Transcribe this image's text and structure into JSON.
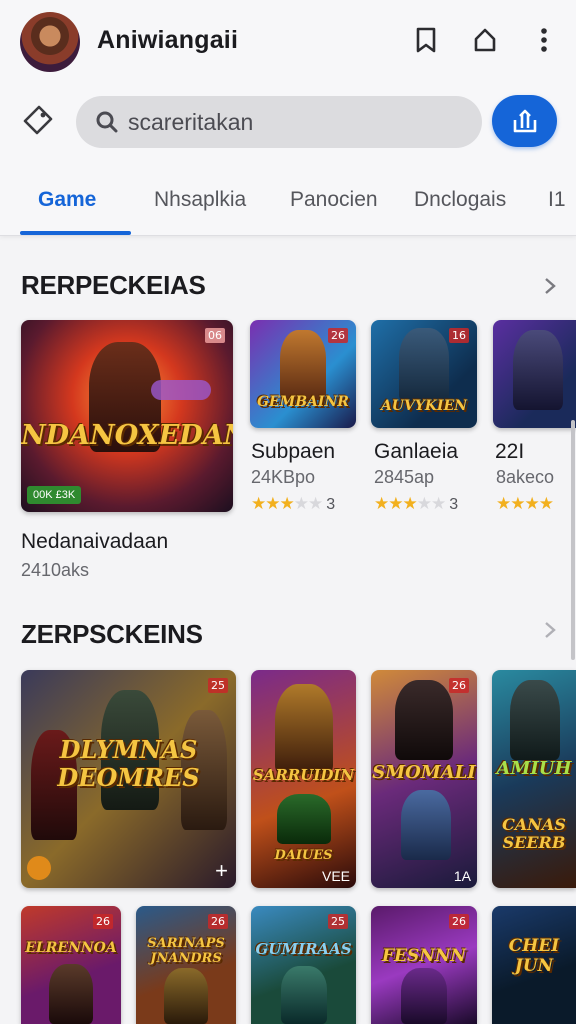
{
  "header": {
    "app_title": "Aniwiangaii",
    "search_placeholder": "scareritakan"
  },
  "tabs": [
    {
      "label": "Game",
      "active": true
    },
    {
      "label": "Nhsaplkia",
      "active": false
    },
    {
      "label": "Panocien",
      "active": false
    },
    {
      "label": "Dnclogais",
      "active": false
    },
    {
      "label": "I1",
      "active": false
    }
  ],
  "section1": {
    "title": "RERPECKEIAS",
    "featured": {
      "art_title": "NDANOXEDAN",
      "badge": "06",
      "footer_badge": "00K £3K",
      "title": "Nedanaivadaan",
      "sub": "2410aks"
    },
    "games": [
      {
        "art_title": "GEMBAINR",
        "badge": "26",
        "title": "Subpaen",
        "sub": "24KBpo",
        "rating": 3
      },
      {
        "art_title": "AUVYKIEN",
        "badge": "16",
        "title": "Ganlaeia",
        "sub": "2845ap",
        "rating": 3
      },
      {
        "art_title": "",
        "badge": "",
        "title": "22I",
        "sub": "8akeco",
        "rating": ""
      }
    ]
  },
  "section2": {
    "title": "ZERPSCKEINS",
    "cards": [
      {
        "art_title": "DLYMNAS DEOMRES",
        "badge": "25",
        "corner": "+"
      },
      {
        "art_title": "SARRUIDIN",
        "sub_art": "DAIUES",
        "badge": "",
        "corner": "VEE"
      },
      {
        "art_title": "SMOMALI",
        "badge": "26",
        "corner": "1A"
      },
      {
        "art_title": "AMIUH",
        "sub_art": "CANAS SEERB",
        "badge": "",
        "corner": ""
      }
    ],
    "cards_row2": [
      {
        "art_title": "ELRENNOA",
        "badge": "26"
      },
      {
        "art_title": "SARINAPS JNANDRS",
        "badge": "26"
      },
      {
        "art_title": "GUMIRAAS",
        "badge": "25"
      },
      {
        "art_title": "FESNNN",
        "badge": "26"
      },
      {
        "art_title": "CHEI JUN",
        "badge": ""
      }
    ]
  },
  "colors": {
    "accent": "#1565d8",
    "star": "#f2b01e"
  }
}
